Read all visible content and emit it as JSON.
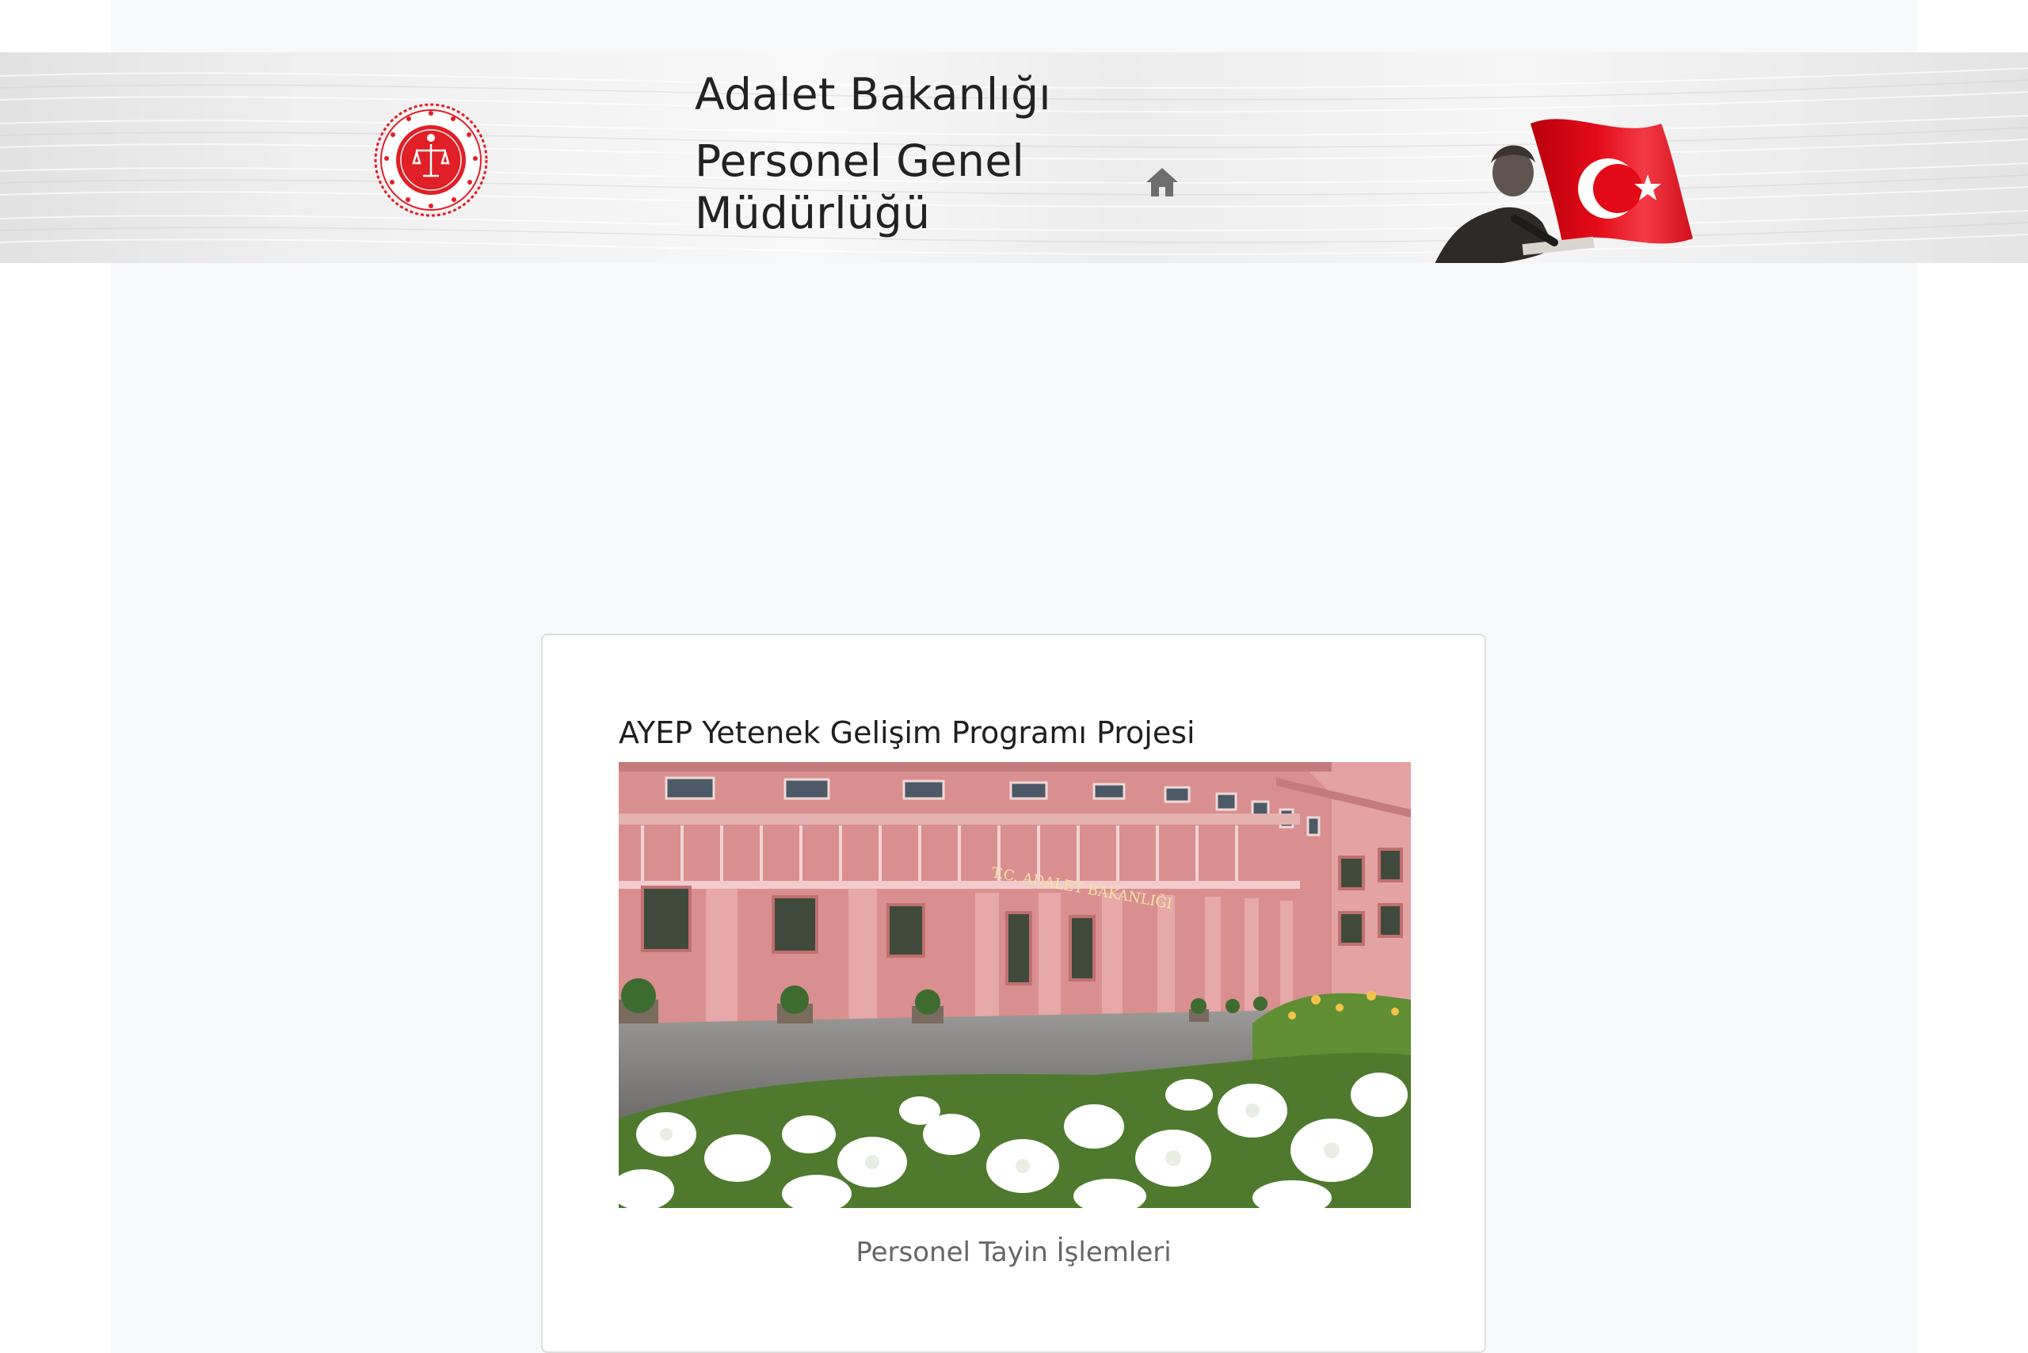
{
  "header": {
    "title_line1": "Adalet Bakanlığı",
    "title_line2": "Personel Genel",
    "title_line3": "Müdürlüğü",
    "emblem_text": "TÜRKİYE CUMHURİYETİ ADALET BAKANLIĞI",
    "icons": {
      "emblem": "ministry-emblem-icon",
      "home": "home-icon",
      "flag": "turkish-flag-icon"
    }
  },
  "card": {
    "title": "AYEP Yetenek Gelişim Programı Projesi",
    "photo_sign": "T.C. ADALET BAKANLIĞI",
    "link_label": "Personel Tayin İşlemleri"
  },
  "colors": {
    "emblem_red": "#e11f26",
    "flag_red": "#e30a17",
    "text_dark": "#222222",
    "link_gray": "#666666",
    "page_bg": "#f7f8fa"
  }
}
